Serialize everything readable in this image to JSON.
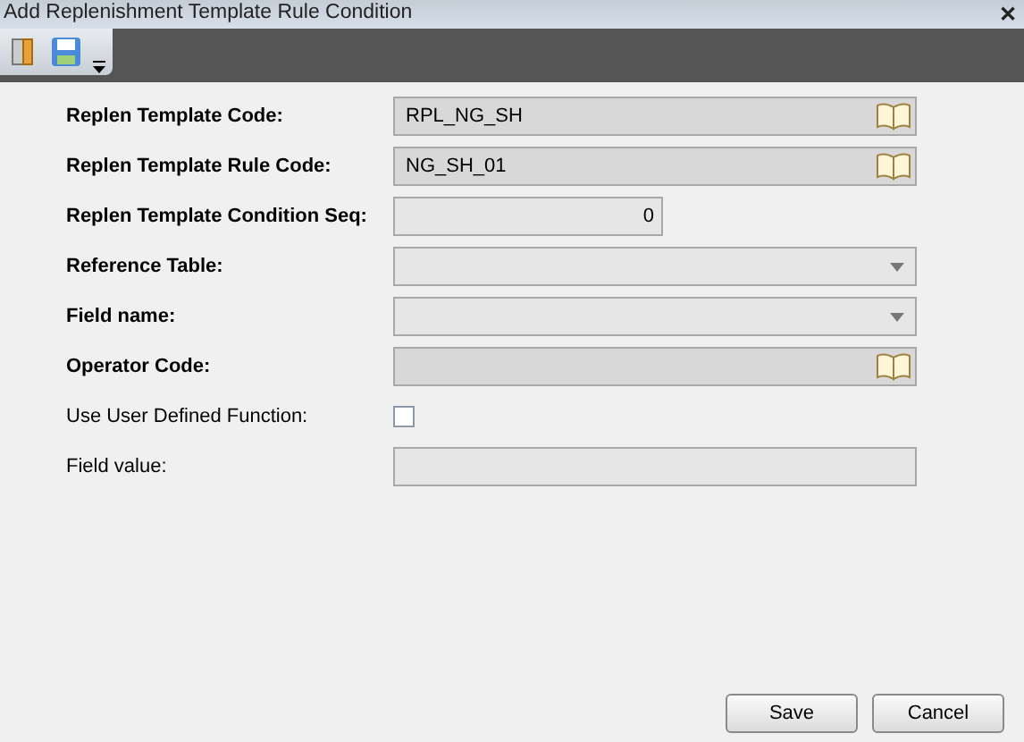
{
  "window": {
    "title": "Add Replenishment Template Rule Condition",
    "close": "✕"
  },
  "fields": [
    {
      "label": "Replen Template Code:",
      "required": true,
      "kind": "lookup",
      "value": "RPL_NG_SH"
    },
    {
      "label": "Replen Template Rule Code:",
      "required": true,
      "kind": "lookup",
      "value": "NG_SH_01"
    },
    {
      "label": "Replen Template Condition Seq:",
      "required": true,
      "kind": "number",
      "value": "0"
    },
    {
      "label": "Reference Table:",
      "required": true,
      "kind": "dropdown"
    },
    {
      "label": "Field name:",
      "required": true,
      "kind": "dropdown"
    },
    {
      "label": "Operator Code:",
      "required": true,
      "kind": "lookup"
    },
    {
      "label": "Use User Defined Function:",
      "required": false,
      "kind": "checkbox",
      "checked": false
    },
    {
      "label": "Field value:",
      "required": false,
      "kind": "text"
    }
  ],
  "buttons": [
    "Save",
    "Cancel"
  ]
}
